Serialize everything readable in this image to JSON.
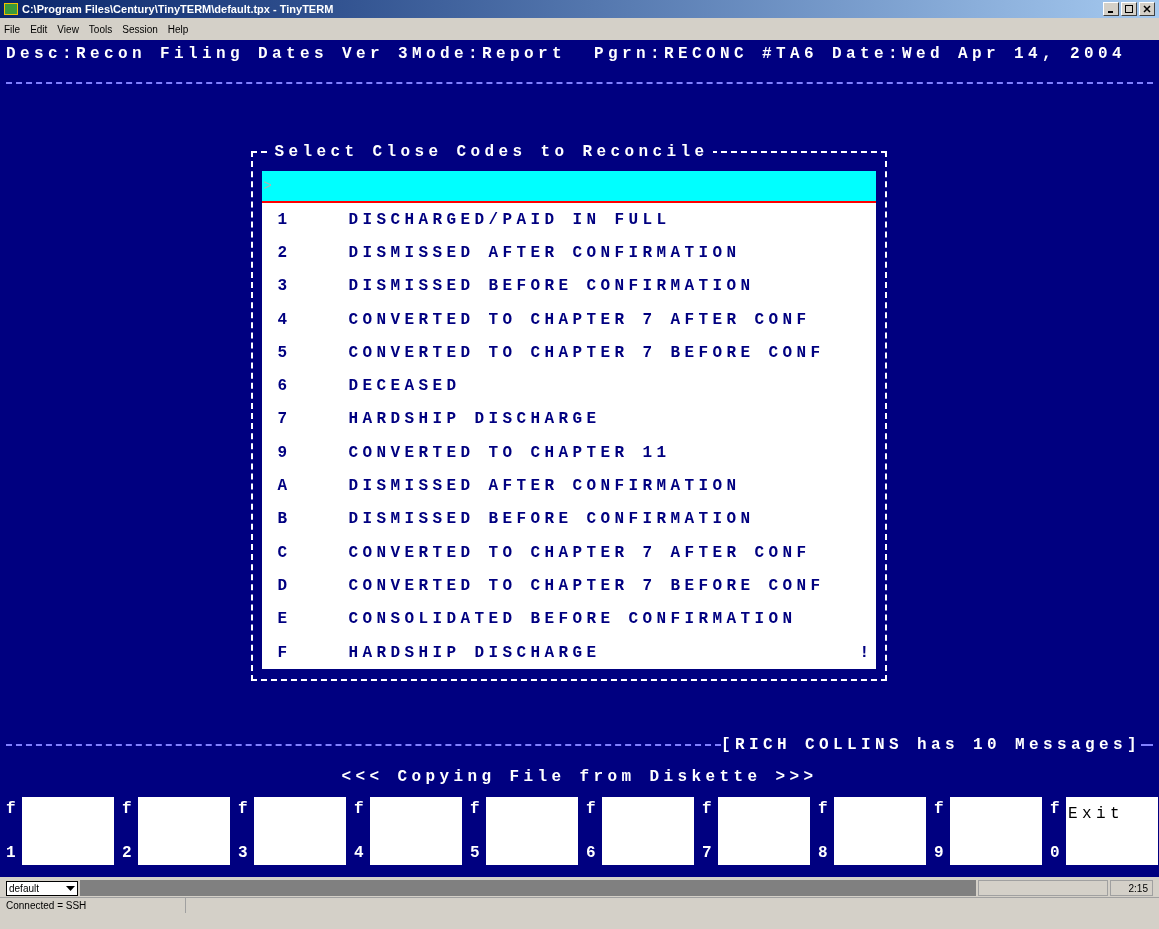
{
  "window": {
    "title": "C:\\Program Files\\Century\\TinyTERM\\default.tpx - TinyTERM"
  },
  "menu": [
    "File",
    "Edit",
    "View",
    "Tools",
    "Session",
    "Help"
  ],
  "terminal": {
    "header": "Desc:Recon Filing Dates Ver 3Mode:Report  Pgrn:RECONC #TA6 Date:Wed Apr 14, 2004",
    "dialog": {
      "title": "Select Close Codes to Reconcile",
      "prompt": ">",
      "more_marker": "!",
      "items": [
        {
          "code": "1",
          "text": "DISCHARGED/PAID IN FULL"
        },
        {
          "code": "2",
          "text": "DISMISSED AFTER CONFIRMATION"
        },
        {
          "code": "3",
          "text": "DISMISSED BEFORE CONFIRMATION"
        },
        {
          "code": "4",
          "text": "CONVERTED TO CHAPTER 7 AFTER CONF"
        },
        {
          "code": "5",
          "text": "CONVERTED TO CHAPTER 7 BEFORE CONF"
        },
        {
          "code": "6",
          "text": "DECEASED"
        },
        {
          "code": "7",
          "text": "HARDSHIP DISCHARGE"
        },
        {
          "code": "9",
          "text": "CONVERTED TO CHAPTER 11"
        },
        {
          "code": "A",
          "text": "DISMISSED AFTER CONFIRMATION"
        },
        {
          "code": "B",
          "text": "DISMISSED BEFORE CONFIRMATION"
        },
        {
          "code": "C",
          "text": "CONVERTED TO CHAPTER 7 AFTER CONF"
        },
        {
          "code": "D",
          "text": "CONVERTED TO CHAPTER 7 BEFORE CONF"
        },
        {
          "code": "E",
          "text": "CONSOLIDATED BEFORE CONFIRMATION"
        },
        {
          "code": "F",
          "text": "HARDSHIP DISCHARGE"
        }
      ]
    },
    "messages": "[RICH COLLINS has 10 Messages]",
    "notice": "<<< Copying File from Diskette >>>",
    "function_keys": [
      {
        "letter": "f",
        "number": "1"
      },
      {
        "letter": "f",
        "number": "2"
      },
      {
        "letter": "f",
        "number": "3"
      },
      {
        "letter": "f",
        "number": "4"
      },
      {
        "letter": "f",
        "number": "5"
      },
      {
        "letter": "f",
        "number": "6"
      },
      {
        "letter": "f",
        "number": "7"
      },
      {
        "letter": "f",
        "number": "8"
      },
      {
        "letter": "f",
        "number": "9"
      },
      {
        "letter": "f",
        "number": "0",
        "label": "Exit"
      }
    ]
  },
  "status_bar": {
    "profile": "default",
    "time": "2:15",
    "connection": "Connected = SSH"
  }
}
